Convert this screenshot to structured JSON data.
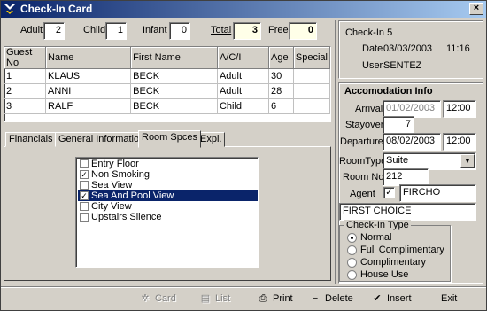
{
  "window": {
    "title": "Check-In Card",
    "close_label": "×"
  },
  "counts": {
    "adult_label": "Adult",
    "adult_value": "2",
    "child_label": "Child",
    "child_value": "1",
    "infant_label": "Infant",
    "infant_value": "0",
    "total_label": "Total",
    "total_value": "3",
    "free_label": "Free",
    "free_value": "0"
  },
  "guests": {
    "columns": [
      "Guest No",
      "Name",
      "First Name",
      "A/C/I",
      "Age",
      "Special"
    ],
    "rows": [
      [
        "1",
        "KLAUS",
        "BECK",
        "Adult",
        "30",
        ""
      ],
      [
        "2",
        "ANNI",
        "BECK",
        "Adult",
        "28",
        ""
      ],
      [
        "3",
        "RALF",
        "BECK",
        "Child",
        "6",
        ""
      ]
    ]
  },
  "tabs": [
    "Financials",
    "General Information",
    "Room Spces",
    "Expl."
  ],
  "room_specs": [
    {
      "label": "Entry Floor",
      "checked": false,
      "selected": false
    },
    {
      "label": "Non Smoking",
      "checked": true,
      "selected": false
    },
    {
      "label": "Sea View",
      "checked": false,
      "selected": false
    },
    {
      "label": "Sea And Pool View",
      "checked": true,
      "selected": true
    },
    {
      "label": "City View",
      "checked": false,
      "selected": false
    },
    {
      "label": "Upstairs Silence",
      "checked": false,
      "selected": false
    }
  ],
  "checkin_info": {
    "checkin_line": "Check-In 5",
    "date_label": "Date",
    "date_value": "03/03/2003",
    "time_value": "11:16",
    "user_label": "User",
    "user_value": "SENTEZ"
  },
  "accomodation": {
    "heading": "Accomodation Info",
    "arrival_label": "Arrival",
    "arrival_date": "01/02/2003",
    "arrival_time": "12:00",
    "stayover_label": "Stayover",
    "stayover_value": "7",
    "departure_label": "Departure",
    "departure_date": "08/02/2003",
    "departure_time": "12:00",
    "roomtype_label": "RoomType",
    "roomtype_value": "Suite",
    "roomno_label": "Room No",
    "roomno_value": "212",
    "agent_label": "Agent",
    "agent_checked": true,
    "agent_code": "FIRCHO",
    "agent_name": "FIRST CHOICE"
  },
  "checkin_type": {
    "title": "Check-In Type",
    "options": [
      "Normal",
      "Full Complimentary",
      "Complimentary",
      "House Use"
    ],
    "selected": 0
  },
  "toolbar": {
    "card_label": "Card",
    "list_label": "List",
    "print_label": "Print",
    "delete_label": "Delete",
    "insert_label": "Insert",
    "exit_label": "Exit"
  }
}
